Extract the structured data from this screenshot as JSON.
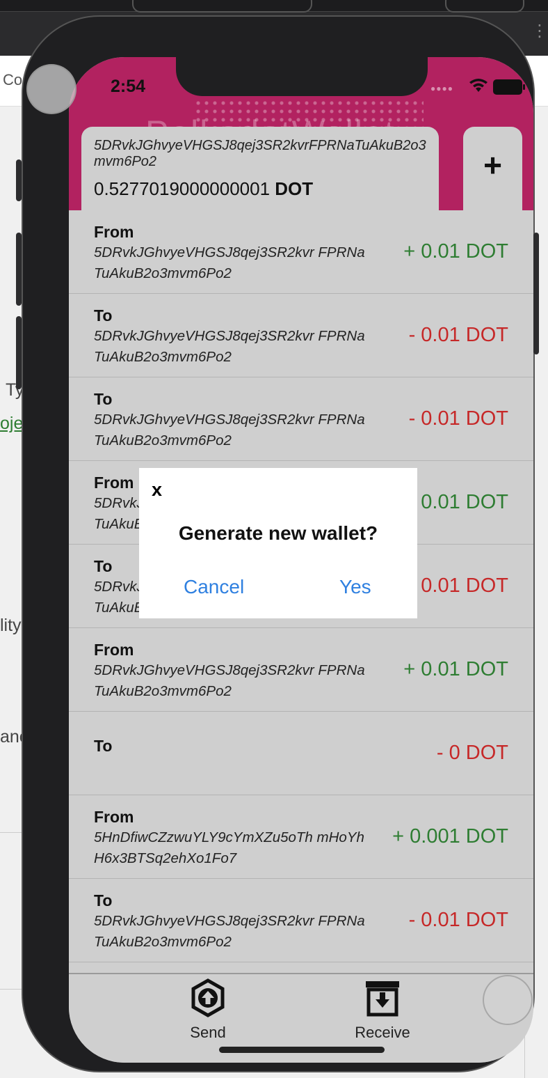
{
  "background": {
    "fragments": [
      "Co",
      "Ty",
      "oje",
      "lity",
      "anc"
    ],
    "link_color": "#2e7d32"
  },
  "status_bar": {
    "time": "2:54"
  },
  "header": {
    "title": "PolkadotWallet",
    "color": "#b22260"
  },
  "wallet": {
    "address": "5DRvkJGhvyeVHGSJ8qej3SR2kvrFPRNaTuAkuB2o3mvm6Po2",
    "balance": "0.5277019000000001",
    "unit": "DOT",
    "add_label": "+"
  },
  "transactions": [
    {
      "direction": "From",
      "address": "5DRvkJGhvyeVHGSJ8qej3SR2kvr FPRNaTuAkuB2o3mvm6Po2",
      "amount": "+ 0.01 DOT",
      "type": "in"
    },
    {
      "direction": "To",
      "address": "5DRvkJGhvyeVHGSJ8qej3SR2kvr FPRNaTuAkuB2o3mvm6Po2",
      "amount": "- 0.01 DOT",
      "type": "out"
    },
    {
      "direction": "To",
      "address": "5DRvkJGhvyeVHGSJ8qej3SR2kvr FPRNaTuAkuB2o3mvm6Po2",
      "amount": "- 0.01 DOT",
      "type": "out"
    },
    {
      "direction": "From",
      "address": "5DRvkJGhvyeVHGSJ8qej3SR2kvr FPRNaTuAkuB2o3mvm6Po2",
      "amount": "+ 0.01 DOT",
      "type": "in"
    },
    {
      "direction": "To",
      "address": "5DRvkJGhvyeVHGSJ8qej3SR2kvr FPRNaTuAkuB2o3mvm6Po2",
      "amount": "- 0.01 DOT",
      "type": "out"
    },
    {
      "direction": "From",
      "address": "5DRvkJGhvyeVHGSJ8qej3SR2kvr FPRNaTuAkuB2o3mvm6Po2",
      "amount": "+ 0.01 DOT",
      "type": "in"
    },
    {
      "direction": "To",
      "address": "",
      "amount": "- 0 DOT",
      "type": "out"
    },
    {
      "direction": "From",
      "address": "5HnDfiwCZzwuYLY9cYmXZu5oTh mHoYhH6x3BTSq2ehXo1Fo7",
      "amount": "+ 0.001 DOT",
      "type": "in"
    },
    {
      "direction": "To",
      "address": "5DRvkJGhvyeVHGSJ8qej3SR2kvr FPRNaTuAkuB2o3mvm6Po2",
      "amount": "- 0.01 DOT",
      "type": "out"
    }
  ],
  "tabbar": {
    "send": {
      "label": "Send",
      "icon": "send-upload-icon"
    },
    "receive": {
      "label": "Receive",
      "icon": "receive-download-icon"
    }
  },
  "dialog": {
    "close_label": "x",
    "title": "Generate new wallet?",
    "cancel_label": "Cancel",
    "confirm_label": "Yes"
  },
  "colors": {
    "positive": "#2e7d32",
    "negative": "#c62828",
    "dialog_button": "#2f80e0"
  }
}
